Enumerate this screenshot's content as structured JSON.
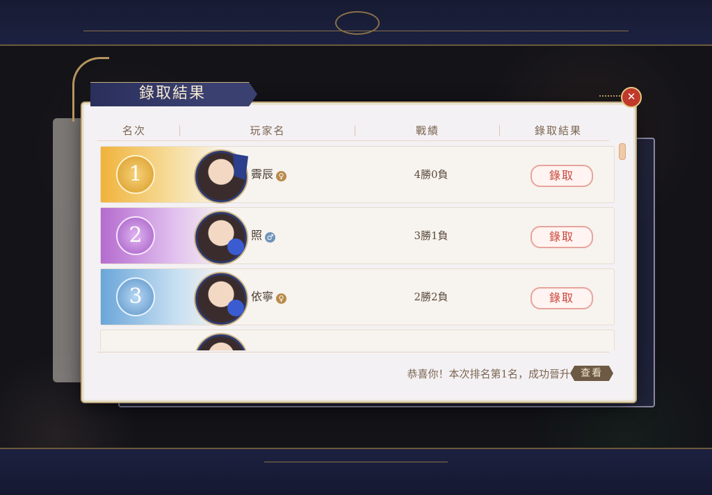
{
  "title": "錄取結果",
  "close_label": "✕",
  "headers": {
    "rank": "名次",
    "player": "玩家名",
    "record": "戰績",
    "result": "錄取結果"
  },
  "rows": [
    {
      "rank": "1",
      "name": "霽辰",
      "gender": "female",
      "record": "4勝0負",
      "result": "錄取"
    },
    {
      "rank": "2",
      "name": "照",
      "gender": "male",
      "record": "3勝1負",
      "result": "錄取"
    },
    {
      "rank": "3",
      "name": "依寧",
      "gender": "female",
      "record": "2勝2負",
      "result": "錄取"
    }
  ],
  "colors": {
    "rank1": "#f0b33c",
    "rank2": "#b56bd0",
    "rank3": "#6aa6d9",
    "accept": "#c8453a"
  },
  "footer": {
    "message": "恭喜你！本次排名第1名，成功晉升",
    "view_label": "查看"
  }
}
